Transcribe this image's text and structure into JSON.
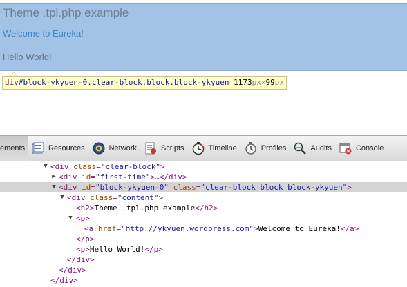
{
  "page": {
    "heading": "Theme .tpl.php example",
    "link_text": "Welcome to Eureka!",
    "paragraph": "Hello World!"
  },
  "tooltip": {
    "tag": "div",
    "selector_rest": "#block-ykyuen-0.clear-block.block.block-ykyuen",
    "width": "1173",
    "unit_w": "px",
    "times": "×",
    "height": "99",
    "unit_h": "px"
  },
  "toolbar": {
    "items": [
      {
        "label": "ements",
        "icon": "elements-icon",
        "selected": true
      },
      {
        "label": "Resources",
        "icon": "resources-icon"
      },
      {
        "label": "Network",
        "icon": "network-icon"
      },
      {
        "label": "Scripts",
        "icon": "scripts-icon"
      },
      {
        "label": "Timeline",
        "icon": "timeline-icon"
      },
      {
        "label": "Profiles",
        "icon": "profiles-icon"
      },
      {
        "label": "Audits",
        "icon": "audits-icon"
      },
      {
        "label": "Console",
        "icon": "console-icon"
      }
    ]
  },
  "tree": {
    "r1": {
      "open": "<div",
      "attr1": "class",
      "eq": "=",
      "val1": "\"clear-block\"",
      "close": ">"
    },
    "r2": {
      "open": "<div",
      "attr1": "id",
      "val1": "\"first-time\"",
      "mid": ">…</div>"
    },
    "r3": {
      "open": "<div",
      "attr1": "id",
      "val1": "\"block-ykyuen-0\"",
      "attr2": "class",
      "val2": "\"clear-block block block-ykyuen\"",
      "close": ">"
    },
    "r4": {
      "open": "<div",
      "attr1": "class",
      "val1": "\"content\"",
      "close": ">"
    },
    "r5": {
      "open": "<h2>",
      "text": "Theme .tpl.php example",
      "close": "</h2>"
    },
    "r6": {
      "open": "<p>"
    },
    "r7": {
      "open": "<a",
      "attr1": "href",
      "val1": "\"http://ykyuen.wordpress.com\"",
      "close": ">",
      "text": "Welcome to Eureka!",
      "end": "</a>"
    },
    "r8": {
      "close": "</p>"
    },
    "r9": {
      "open": "<p>",
      "text": "Hello World!",
      "close": "</p>"
    },
    "r10": {
      "close": "</div>"
    },
    "r11": {
      "close": "</div>"
    },
    "r12": {
      "close": "</div>"
    }
  }
}
